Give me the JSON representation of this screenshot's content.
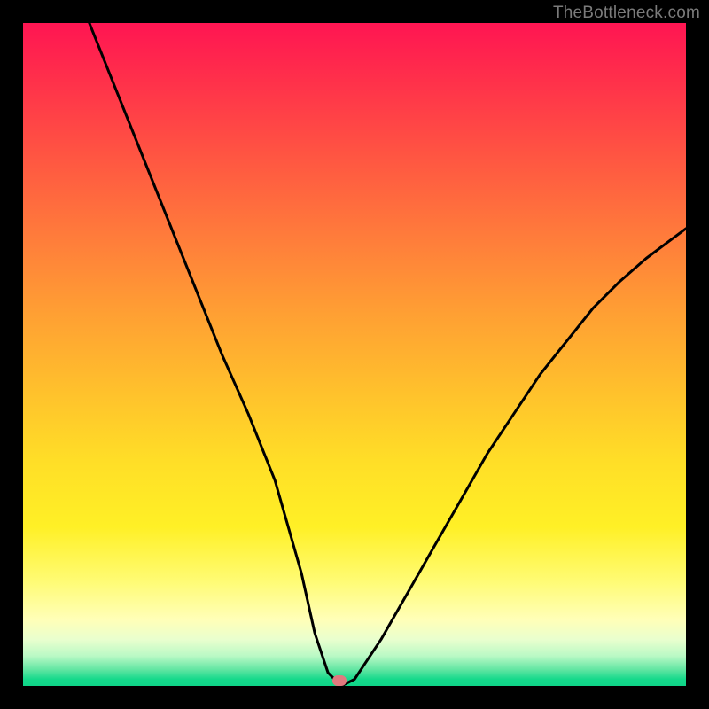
{
  "watermark": {
    "text": "TheBottleneck.com"
  },
  "marker": {
    "color": "#e07a7f",
    "x_pct": 47.7,
    "y_pct": 99.2
  },
  "chart_data": {
    "type": "line",
    "title": "",
    "xlabel": "",
    "ylabel": "",
    "xlim": [
      0,
      100
    ],
    "ylim": [
      0,
      100
    ],
    "grid": false,
    "legend": false,
    "background_gradient": {
      "direction": "vertical",
      "stops": [
        {
          "pos": 0,
          "color": "#ff1552"
        },
        {
          "pos": 50,
          "color": "#ff9a37"
        },
        {
          "pos": 76,
          "color": "#fff026"
        },
        {
          "pos": 92,
          "color": "#ffffc0"
        },
        {
          "pos": 100,
          "color": "#0fd488"
        }
      ]
    },
    "series": [
      {
        "name": "bottleneck-curve",
        "color": "#000000",
        "stroke_width": 3,
        "x": [
          10,
          14,
          18,
          22,
          26,
          30,
          34,
          38,
          42,
          44,
          46,
          48,
          50,
          54,
          58,
          62,
          66,
          70,
          74,
          78,
          82,
          86,
          90,
          94,
          98,
          100
        ],
        "y": [
          100,
          90,
          80,
          70,
          60,
          50,
          41,
          31,
          17,
          8,
          2,
          0,
          1,
          7,
          14,
          21,
          28,
          35,
          41,
          47,
          52,
          57,
          61,
          64.5,
          67.5,
          69
        ]
      }
    ],
    "marker_point": {
      "x": 47.7,
      "y": 0.8,
      "color": "#e07a7f"
    }
  }
}
